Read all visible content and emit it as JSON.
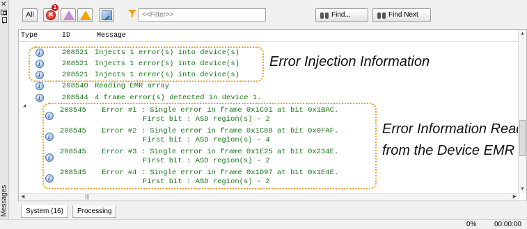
{
  "dock": {
    "label": "Messages",
    "close_icon": "close-icon",
    "float_icon": "float-icon",
    "pin_icon": "pin-icon"
  },
  "toolbar": {
    "all_label": "All",
    "error_badge": "1",
    "filter_placeholder": "<<Filter>>",
    "find_label": "Find...",
    "find_next_label": "Find Next",
    "icons": [
      "error-filter-icon",
      "critical-warning-filter-icon",
      "warning-filter-icon",
      "info-filter-icon",
      "filter-funnel-icon",
      "binoculars-icon"
    ]
  },
  "table": {
    "headers": {
      "type": "Type",
      "id": "ID",
      "message": "Message"
    },
    "rows": [
      {
        "id": "208521",
        "message": "Injects 1 error(s) into device(s)",
        "indent": 0
      },
      {
        "id": "208521",
        "message": "Injects 1 error(s) into device(s)",
        "indent": 0
      },
      {
        "id": "208521",
        "message": "Injects 1 error(s) into device(s)",
        "indent": 0
      },
      {
        "id": "208540",
        "message": "Reading EMR array",
        "indent": 0
      },
      {
        "id": "208544",
        "message": "4 frame error(s) detected in device 1.",
        "indent": 0,
        "expanded": true
      }
    ],
    "children": [
      {
        "id": "208545",
        "line1": "Error #1 : Single error in frame 0x1C91 at bit 0x1BAC.",
        "line2": "First bit : ASD region(s) - 2"
      },
      {
        "id": "208545",
        "line1": "Error #2 : Single error in frame 0x1C88 at bit 0x0FAF.",
        "line2": "First bit : ASD region(s) - 4"
      },
      {
        "id": "208545",
        "line1": "Error #3 : Single error in frame 0x1E25 at bit 0x234E.",
        "line2": "First bit : ASD region(s) - 2"
      },
      {
        "id": "208545",
        "line1": "Error #4 : Single error in frame 0x1D97 at bit 0x1E4E.",
        "line2": "First bit : ASD region(s) - 2"
      }
    ]
  },
  "callouts": {
    "injection": "Error Injection Information",
    "read_line1": "Error Information Read",
    "read_line2": "from the Device EMR"
  },
  "tabs": {
    "system": "System (16)",
    "processing": "Processing"
  },
  "status": {
    "progress": "0%",
    "time": "00:00:00"
  },
  "colors": {
    "message_text": "#177517",
    "callout_border": "#f1a12b"
  }
}
